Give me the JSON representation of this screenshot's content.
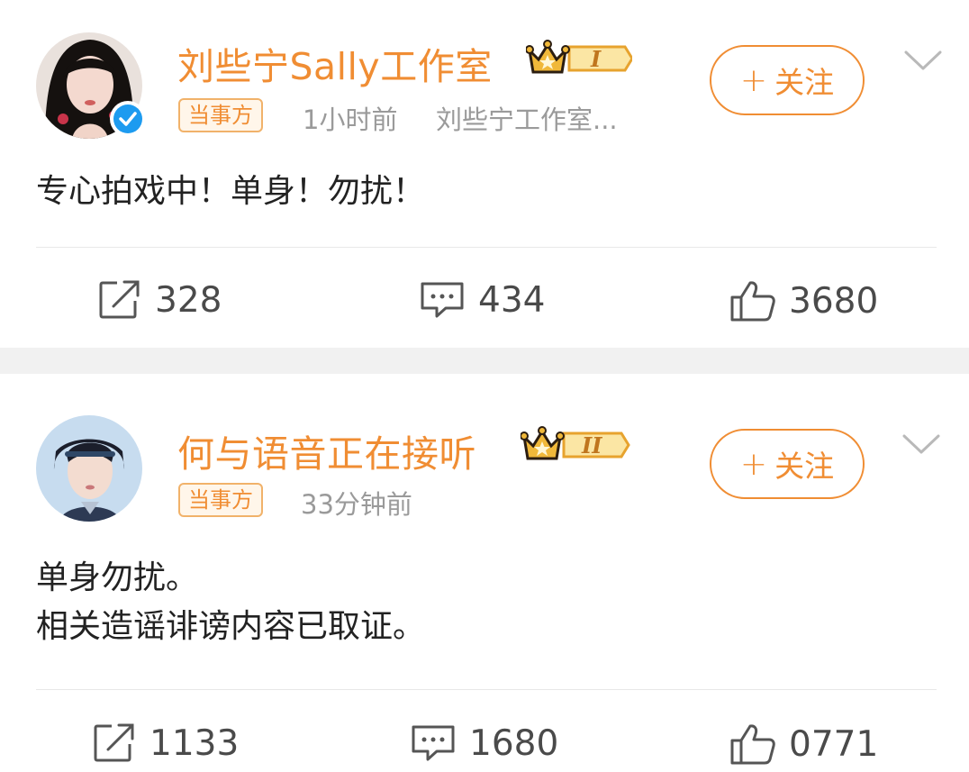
{
  "posts": [
    {
      "author": "刘些宁Sally工作室",
      "level_badge": "I",
      "party_tag": "当事方",
      "time": "1小时前",
      "source": "刘些宁工作室...",
      "follow_label": "关注",
      "content": [
        "专心拍戏中！单身！勿扰！"
      ],
      "repost_count": "328",
      "comment_count": "434",
      "like_count": "3680",
      "verified": true
    },
    {
      "author": "何与语音正在接听",
      "level_badge": "II",
      "party_tag": "当事方",
      "time": "33分钟前",
      "source": "",
      "follow_label": "关注",
      "content": [
        "单身勿扰。",
        "相关造谣诽谤内容已取证。"
      ],
      "repost_count": "1133",
      "comment_count": "1680",
      "like_count": "0771",
      "verified": false
    }
  ],
  "icons": {
    "repost": "repost-icon",
    "comment": "comment-icon",
    "like": "like-icon",
    "chevron": "chevron-down-icon",
    "crown": "crown-icon",
    "verified": "verified-icon"
  },
  "colors": {
    "accent": "#f08d33",
    "meta": "#9a9a9a",
    "verified": "#1d9bf0",
    "separator": "#f1f1f1"
  }
}
